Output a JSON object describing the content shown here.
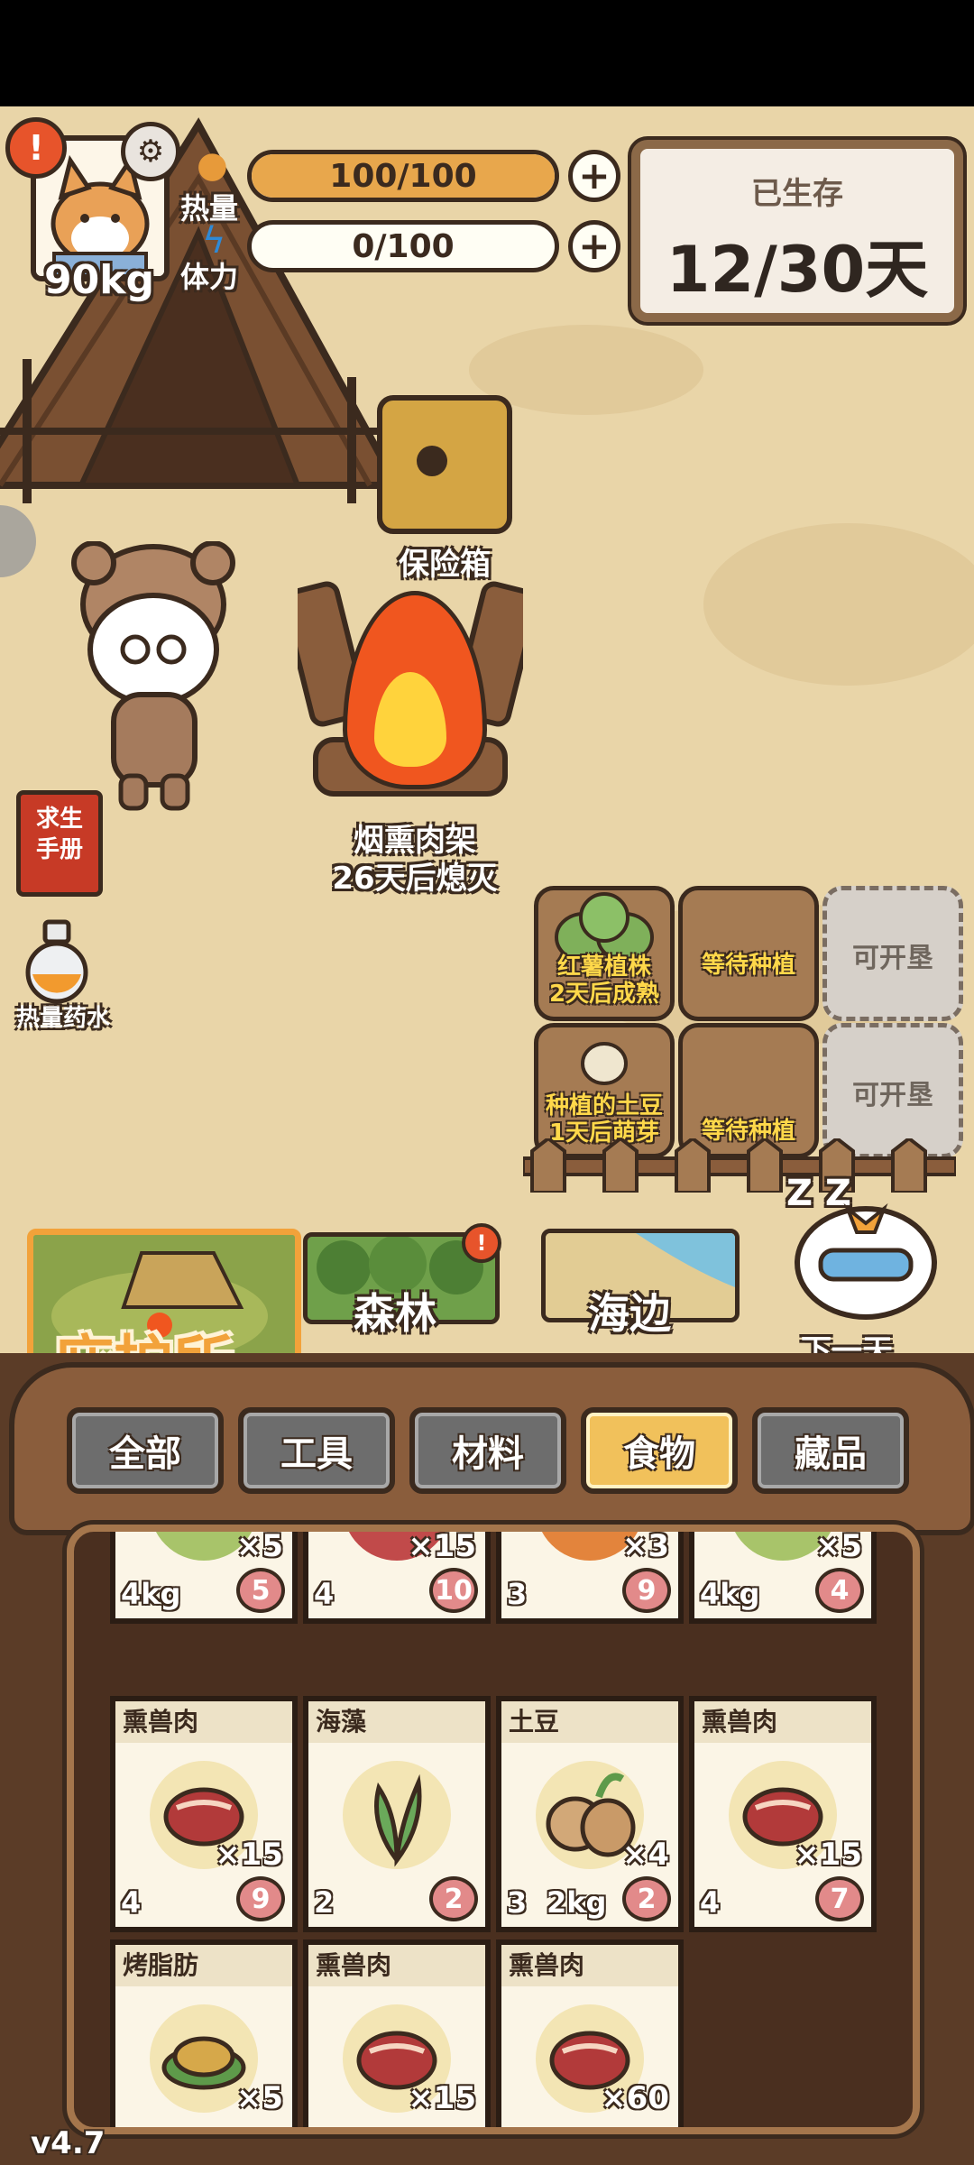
{
  "player": {
    "weight": "90kg",
    "alert": "!"
  },
  "stats": {
    "calories": {
      "label": "热量",
      "value": "100/100",
      "fill": 1.0
    },
    "stamina": {
      "label": "体力",
      "value": "0/100",
      "fill": 0.0
    }
  },
  "survival": {
    "title": "已生存",
    "days": "12/30天"
  },
  "scene": {
    "safe_label": "保险箱",
    "fire_label": "烟熏肉架",
    "fire_timer": "26天后熄灭",
    "survival_manual": "求生手册",
    "potion_label": "热量药水"
  },
  "plots": [
    {
      "label": "红薯植株\n2天后成熟"
    },
    {
      "label": "等待种植"
    },
    {
      "label": "可开垦"
    },
    {
      "label": "种植的土豆\n1天后萌芽"
    },
    {
      "label": "等待种植"
    },
    {
      "label": "可开垦"
    }
  ],
  "locations": {
    "shelter": "庇护所",
    "forest": "森林",
    "beach": "海边",
    "next_day": "下一天",
    "sleep": "Z Z"
  },
  "tabs": [
    "全部",
    "工具",
    "材料",
    "食物",
    "藏品"
  ],
  "active_tab": "食物",
  "top_row": [
    {
      "qty": "×5",
      "val": "4kg",
      "pig": "5"
    },
    {
      "qty": "×15",
      "val": "4",
      "pig": "10"
    },
    {
      "qty": "×3",
      "val": "3",
      "pig": "9"
    },
    {
      "qty": "×5",
      "val": "4kg",
      "pig": "4"
    }
  ],
  "items": [
    {
      "name": "熏兽肉",
      "qty": "×15",
      "val": "4",
      "wt": "",
      "pig": "9"
    },
    {
      "name": "海藻",
      "qty": "",
      "val": "2",
      "wt": "",
      "pig": "2"
    },
    {
      "name": "土豆",
      "qty": "×4",
      "val": "3",
      "wt": "2kg",
      "pig": "2"
    },
    {
      "name": "熏兽肉",
      "qty": "×15",
      "val": "4",
      "wt": "",
      "pig": "7"
    },
    {
      "name": "烤脂肪",
      "qty": "×5",
      "val": "",
      "wt": "",
      "pig": ""
    },
    {
      "name": "熏兽肉",
      "qty": "×15",
      "val": "",
      "wt": "",
      "pig": ""
    },
    {
      "name": "熏兽肉",
      "qty": "×60",
      "val": "",
      "wt": "",
      "pig": ""
    }
  ],
  "version": "v4.7",
  "colors": {
    "accent": "#f1c15b",
    "alert": "#e7542b",
    "ground": "#e9d5a8"
  }
}
